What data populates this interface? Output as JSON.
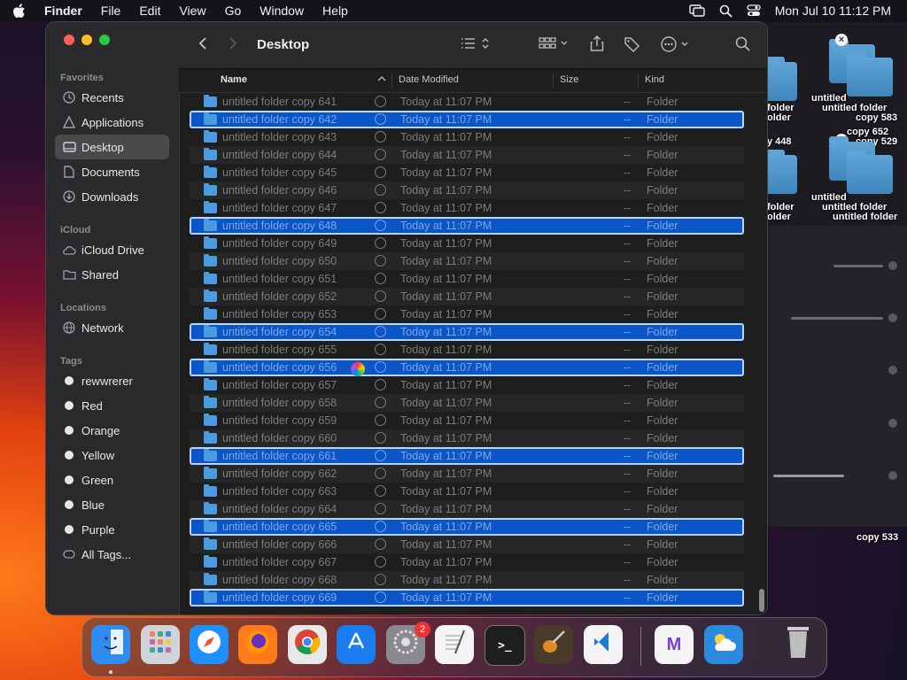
{
  "menubar": {
    "app_name": "Finder",
    "menus": [
      "File",
      "Edit",
      "View",
      "Go",
      "Window",
      "Help"
    ],
    "clock": "Mon Jul 10  11:12 PM"
  },
  "sidebar": {
    "favorites_header": "Favorites",
    "favorites": [
      {
        "label": "Recents",
        "icon": "clock-icon"
      },
      {
        "label": "Applications",
        "icon": "applications-icon"
      },
      {
        "label": "Desktop",
        "icon": "desktop-icon",
        "selected": true
      },
      {
        "label": "Documents",
        "icon": "document-icon"
      },
      {
        "label": "Downloads",
        "icon": "download-icon"
      }
    ],
    "icloud_header": "iCloud",
    "icloud": [
      {
        "label": "iCloud Drive",
        "icon": "cloud-icon"
      },
      {
        "label": "Shared",
        "icon": "shared-folder-icon"
      }
    ],
    "locations_header": "Locations",
    "locations": [
      {
        "label": "Network",
        "icon": "globe-icon"
      }
    ],
    "tags_header": "Tags",
    "tags": [
      "rewwrerer",
      "Red",
      "Orange",
      "Yellow",
      "Green",
      "Blue",
      "Purple",
      "All Tags..."
    ]
  },
  "toolbar": {
    "title": "Desktop"
  },
  "columns": {
    "name": "Name",
    "date": "Date Modified",
    "size": "Size",
    "kind": "Kind"
  },
  "rows": [
    {
      "name": "untitled folder copy 641",
      "date": "Today at 11:07 PM",
      "size": "--",
      "kind": "Folder",
      "selected": false
    },
    {
      "name": "untitled folder copy 642",
      "date": "Today at 11:07 PM",
      "size": "--",
      "kind": "Folder",
      "selected": true
    },
    {
      "name": "untitled folder copy 643",
      "date": "Today at 11:07 PM",
      "size": "--",
      "kind": "Folder",
      "selected": false
    },
    {
      "name": "untitled folder copy 644",
      "date": "Today at 11:07 PM",
      "size": "--",
      "kind": "Folder",
      "selected": false
    },
    {
      "name": "untitled folder copy 645",
      "date": "Today at 11:07 PM",
      "size": "--",
      "kind": "Folder",
      "selected": false
    },
    {
      "name": "untitled folder copy 646",
      "date": "Today at 11:07 PM",
      "size": "--",
      "kind": "Folder",
      "selected": false
    },
    {
      "name": "untitled folder copy 647",
      "date": "Today at 11:07 PM",
      "size": "--",
      "kind": "Folder",
      "selected": false
    },
    {
      "name": "untitled folder copy 648",
      "date": "Today at 11:07 PM",
      "size": "--",
      "kind": "Folder",
      "selected": true
    },
    {
      "name": "untitled folder copy 649",
      "date": "Today at 11:07 PM",
      "size": "--",
      "kind": "Folder",
      "selected": false
    },
    {
      "name": "untitled folder copy 650",
      "date": "Today at 11:07 PM",
      "size": "--",
      "kind": "Folder",
      "selected": false
    },
    {
      "name": "untitled folder copy 651",
      "date": "Today at 11:07 PM",
      "size": "--",
      "kind": "Folder",
      "selected": false
    },
    {
      "name": "untitled folder copy 652",
      "date": "Today at 11:07 PM",
      "size": "--",
      "kind": "Folder",
      "selected": false
    },
    {
      "name": "untitled folder copy 653",
      "date": "Today at 11:07 PM",
      "size": "--",
      "kind": "Folder",
      "selected": false
    },
    {
      "name": "untitled folder copy 654",
      "date": "Today at 11:07 PM",
      "size": "--",
      "kind": "Folder",
      "selected": true
    },
    {
      "name": "untitled folder copy 655",
      "date": "Today at 11:07 PM",
      "size": "--",
      "kind": "Folder",
      "selected": false
    },
    {
      "name": "untitled folder copy 656",
      "date": "Today at 11:07 PM",
      "size": "--",
      "kind": "Folder",
      "selected": true
    },
    {
      "name": "untitled folder copy 657",
      "date": "Today at 11:07 PM",
      "size": "--",
      "kind": "Folder",
      "selected": false
    },
    {
      "name": "untitled folder copy 658",
      "date": "Today at 11:07 PM",
      "size": "--",
      "kind": "Folder",
      "selected": false
    },
    {
      "name": "untitled folder copy 659",
      "date": "Today at 11:07 PM",
      "size": "--",
      "kind": "Folder",
      "selected": false
    },
    {
      "name": "untitled folder copy 660",
      "date": "Today at 11:07 PM",
      "size": "--",
      "kind": "Folder",
      "selected": false
    },
    {
      "name": "untitled folder copy 661",
      "date": "Today at 11:07 PM",
      "size": "--",
      "kind": "Folder",
      "selected": true
    },
    {
      "name": "untitled folder copy 662",
      "date": "Today at 11:07 PM",
      "size": "--",
      "kind": "Folder",
      "selected": false
    },
    {
      "name": "untitled folder copy 663",
      "date": "Today at 11:07 PM",
      "size": "--",
      "kind": "Folder",
      "selected": false
    },
    {
      "name": "untitled folder copy 664",
      "date": "Today at 11:07 PM",
      "size": "--",
      "kind": "Folder",
      "selected": false
    },
    {
      "name": "untitled folder copy 665",
      "date": "Today at 11:07 PM",
      "size": "--",
      "kind": "Folder",
      "selected": true
    },
    {
      "name": "untitled folder copy 666",
      "date": "Today at 11:07 PM",
      "size": "--",
      "kind": "Folder",
      "selected": false
    },
    {
      "name": "untitled folder copy 667",
      "date": "Today at 11:07 PM",
      "size": "--",
      "kind": "Folder",
      "selected": false
    },
    {
      "name": "untitled folder copy 668",
      "date": "Today at 11:07 PM",
      "size": "--",
      "kind": "Folder",
      "selected": false
    },
    {
      "name": "untitled folder copy 669",
      "date": "Today at 11:07 PM",
      "size": "--",
      "kind": "Folder",
      "selected": true
    }
  ],
  "desktop_labels": [
    "untitled",
    "folder",
    "older",
    "untitled folder",
    "copy 583",
    "older",
    "y 448",
    "copy 652",
    "copy 529",
    "untitled",
    "folder",
    "older",
    "untitled folder",
    "untitled folder",
    "copy 533"
  ],
  "dock": {
    "apps": [
      {
        "name": "finder-app",
        "icon": "finder-icon",
        "color": "#2f8cf0"
      },
      {
        "name": "launchpad-app",
        "icon": "launchpad-icon",
        "color": "#cfd3da"
      },
      {
        "name": "safari-app",
        "icon": "safari-icon",
        "color": "#1e90ff"
      },
      {
        "name": "firefox-app",
        "icon": "firefox-icon",
        "color": "#ff7a1a"
      },
      {
        "name": "chrome-app",
        "icon": "chrome-icon",
        "color": "#e8e8e8"
      },
      {
        "name": "app-store-app",
        "icon": "app-store-icon",
        "color": "#1b7cf0"
      },
      {
        "name": "system-settings-app",
        "icon": "settings-icon",
        "color": "#8a8a8e"
      },
      {
        "name": "textedit-app",
        "icon": "textedit-icon",
        "color": "#f4f4f4"
      },
      {
        "name": "terminal-app",
        "icon": "terminal-icon",
        "color": "#1e1e1e"
      },
      {
        "name": "garageband-app",
        "icon": "guitar-icon",
        "color": "#4a3a2a"
      },
      {
        "name": "vscode-app",
        "icon": "vscode-icon",
        "color": "#f4f4f4"
      },
      {
        "name": "visual-studio-app",
        "icon": "visual-studio-icon",
        "color": "#f4f4f4"
      },
      {
        "name": "weather-app",
        "icon": "weather-icon",
        "color": "#2a8ae0"
      },
      {
        "name": "trash-app",
        "icon": "trash-icon",
        "color": "#9a9a9a"
      }
    ],
    "settings_badge": "2",
    "terminal_glyph": ">_",
    "vs_glyph": "M"
  }
}
